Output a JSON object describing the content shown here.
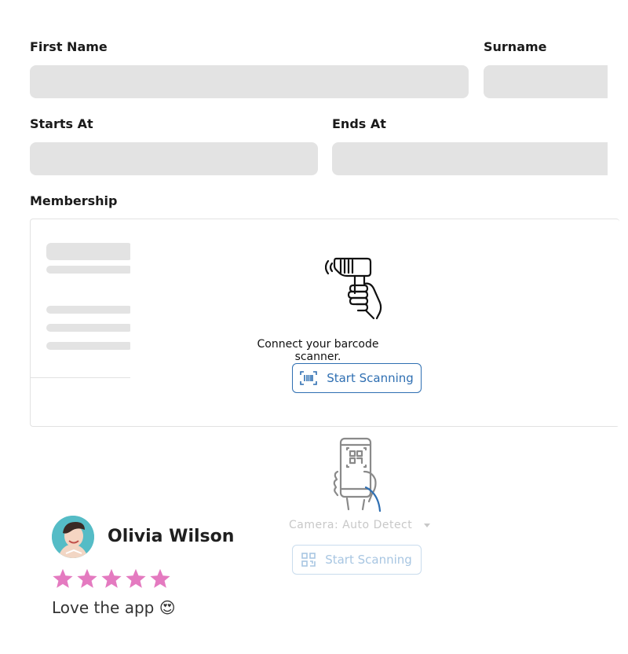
{
  "form": {
    "first_name_label": "First Name",
    "surname_label": "Surname",
    "starts_at_label": "Starts At",
    "ends_at_label": "Ends At",
    "membership_label": "Membership"
  },
  "scanner": {
    "message": "Connect your barcode scanner.",
    "start_label": "Start Scanning",
    "icon": "barcode-scanner-hand-icon",
    "button_icon": "barcode-icon"
  },
  "camera": {
    "select_value": "Camera: Auto Detect",
    "start_label": "Start Scanning",
    "icon": "phone-qr-hand-icon",
    "button_icon": "qr-code-icon"
  },
  "review": {
    "name": "Olivia Wilson",
    "rating": 5,
    "rating_max": 5,
    "text": "Love the app",
    "emoji": "😍",
    "star_color": "#e47ac0"
  },
  "colors": {
    "accent": "#2f6fb2",
    "field": "#e3e3e3"
  }
}
